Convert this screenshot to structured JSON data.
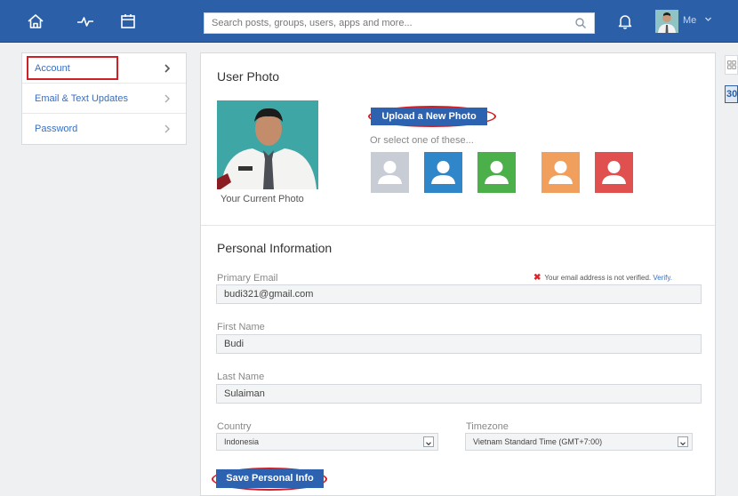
{
  "search": {
    "placeholder": "Search posts, groups, users, apps and more..."
  },
  "header": {
    "me_label": "Me"
  },
  "sidebar": {
    "items": [
      {
        "label": "Account"
      },
      {
        "label": "Email & Text Updates"
      },
      {
        "label": "Password"
      }
    ]
  },
  "user_photo": {
    "title": "User Photo",
    "current_caption": "Your Current Photo",
    "upload_label": "Upload a New Photo",
    "or_select": "Or select one of these...",
    "avatar_colors": [
      "#c8ccd4",
      "#2f86c8",
      "#4cb04a",
      "#f0a05c",
      "#e0504f"
    ]
  },
  "personal": {
    "title": "Personal Information",
    "email_label": "Primary Email",
    "email_value": "budi321@gmail.com",
    "verify_text": "Your email address is not verified.",
    "verify_link": "Verify.",
    "first_label": "First Name",
    "first_value": "Budi",
    "last_label": "Last Name",
    "last_value": "Sulaiman",
    "country_label": "Country",
    "country_value": "Indonesia",
    "timezone_label": "Timezone",
    "timezone_value": "Vietnam Standard Time (GMT+7:00)",
    "save_label": "Save Personal Info"
  },
  "right_widget": {
    "badge_text": "30"
  },
  "colors": {
    "topbar": "#2b5fa8",
    "link": "#3a6fbf",
    "button": "#2d62b0",
    "highlight": "#d02027"
  }
}
